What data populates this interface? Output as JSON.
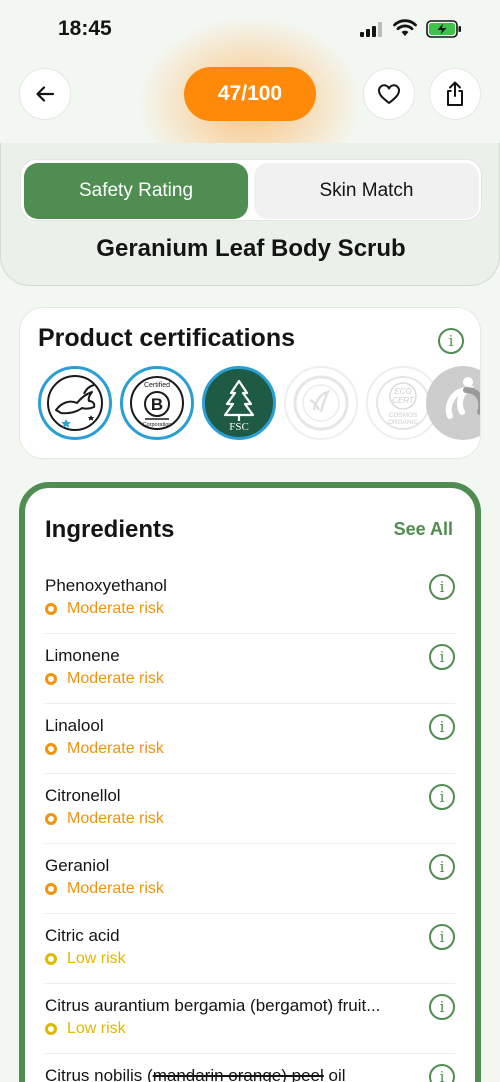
{
  "status_bar": {
    "time": "18:45"
  },
  "header": {
    "score": "47/100",
    "accent_color": "#ff8a0a"
  },
  "tabs": [
    {
      "label": "Safety Rating",
      "active": true
    },
    {
      "label": "Skin Match",
      "active": false
    }
  ],
  "product": {
    "name": "Geranium Leaf Body Scrub"
  },
  "certifications": {
    "title": "Product certifications",
    "badges": [
      {
        "icon": "leaping-bunny-icon",
        "state": "active"
      },
      {
        "icon": "b-corp-icon",
        "state": "active",
        "text_top": "Certified",
        "text_mark": "B",
        "text_bottom": "Corporation"
      },
      {
        "icon": "fsc-icon",
        "state": "active",
        "text": "FSC"
      },
      {
        "icon": "natrue-icon",
        "state": "inactive"
      },
      {
        "icon": "ecocert-cosmos-icon",
        "state": "inactive",
        "text_top": "ECO",
        "text_mid": "CERT",
        "text_bottom1": "COSMOS",
        "text_bottom2": "ORGANIC"
      },
      {
        "icon": "fairtrade-icon",
        "state": "inactive"
      }
    ]
  },
  "ingredients": {
    "title": "Ingredients",
    "see_all": "See All",
    "items": [
      {
        "name": "Phenoxyethanol",
        "risk": "Moderate risk",
        "level": "moderate"
      },
      {
        "name": "Limonene",
        "risk": "Moderate risk",
        "level": "moderate"
      },
      {
        "name": "Linalool",
        "risk": "Moderate risk",
        "level": "moderate"
      },
      {
        "name": "Citronellol",
        "risk": "Moderate risk",
        "level": "moderate"
      },
      {
        "name": "Geraniol",
        "risk": "Moderate risk",
        "level": "moderate"
      },
      {
        "name": "Citric acid",
        "risk": "Low risk",
        "level": "low"
      },
      {
        "name": "Citrus aurantium bergamia (bergamot) fruit...",
        "risk": "Low risk",
        "level": "low"
      },
      {
        "name_prefix": "Citrus nobilis (",
        "name_struck": "mandarin orange) peel",
        "name_suffix": " oil",
        "risk": "",
        "level": "low"
      }
    ]
  },
  "colors": {
    "green": "#4f8d50",
    "moderate": "#f0940e",
    "low": "#e0b800"
  }
}
